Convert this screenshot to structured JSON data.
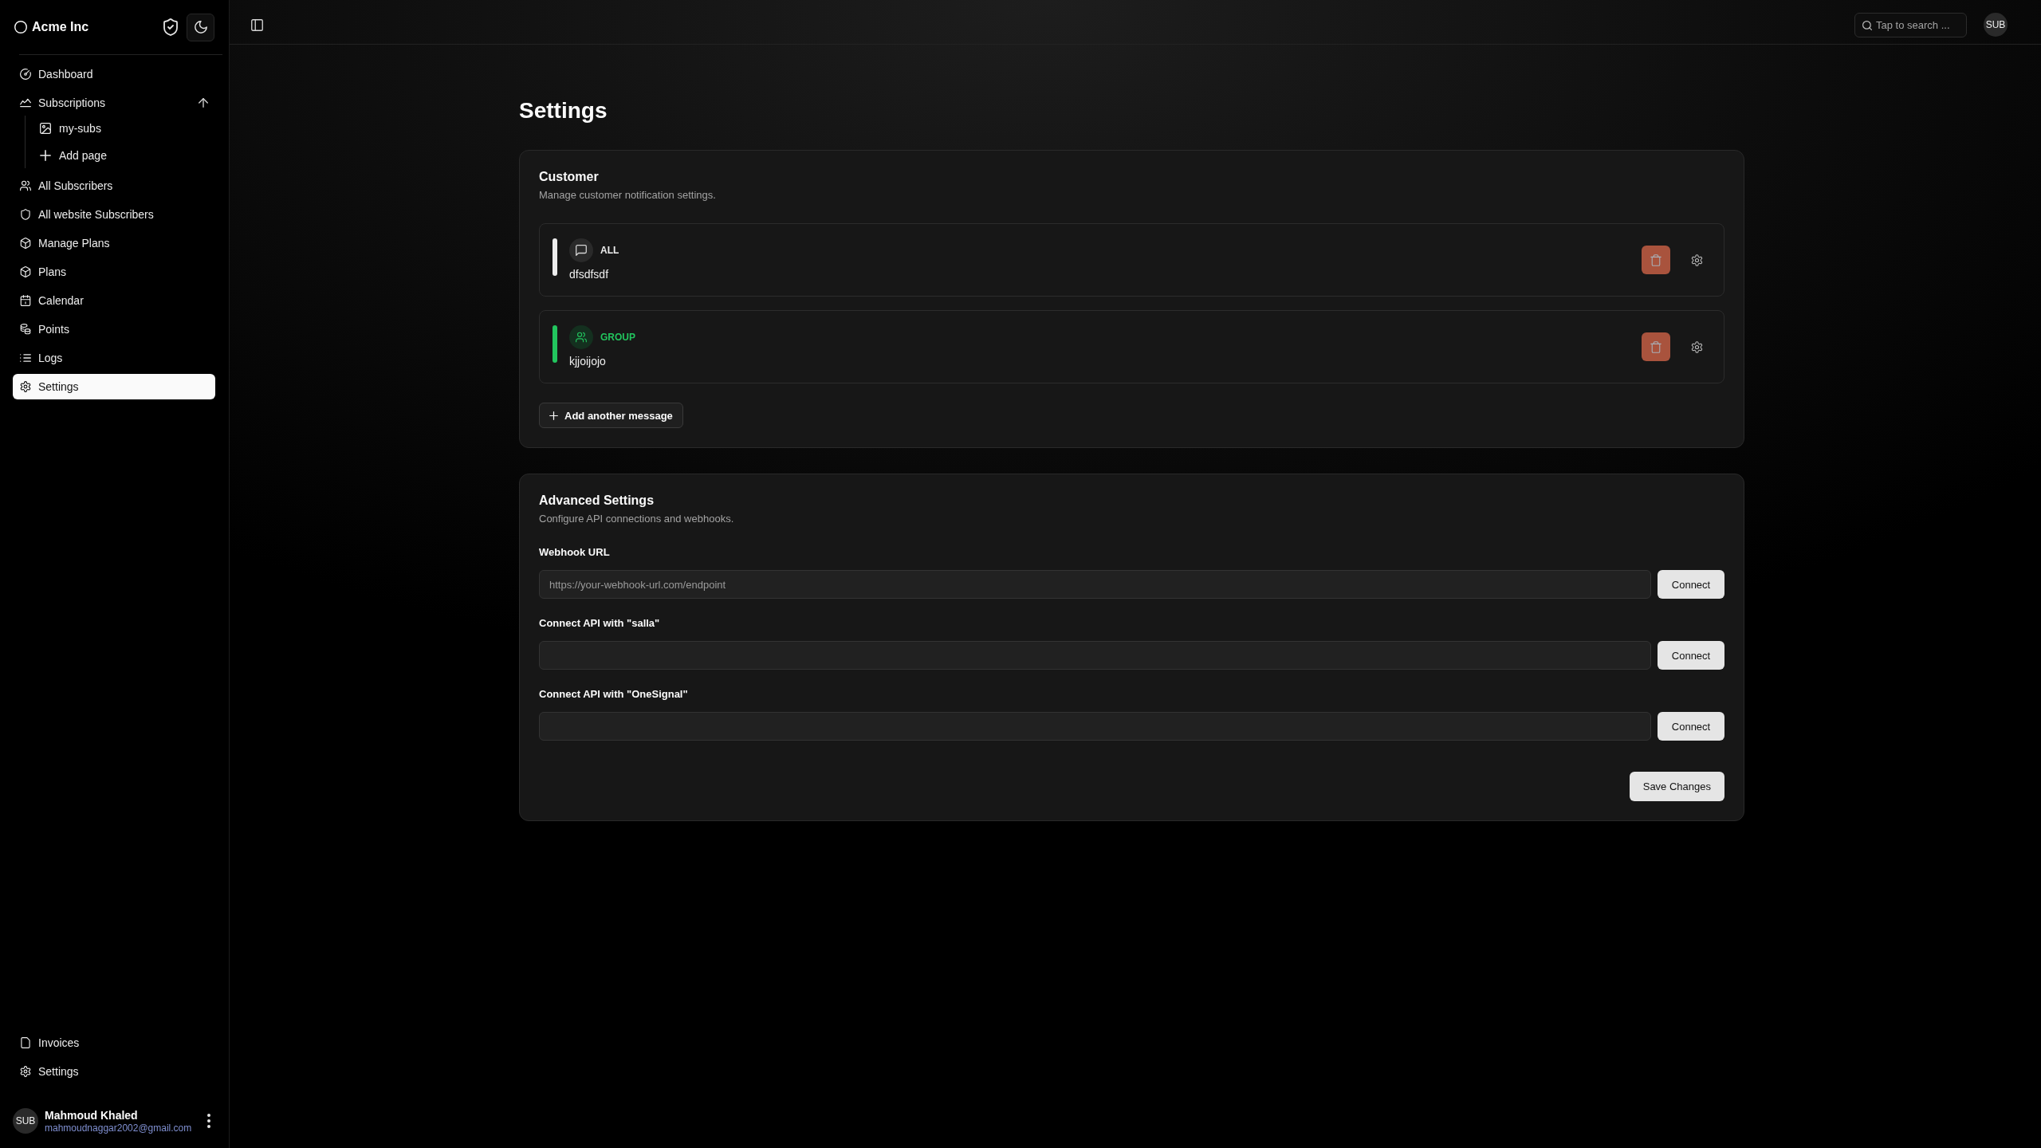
{
  "sidebar": {
    "brand": "Acme Inc",
    "nav": [
      {
        "label": "Dashboard",
        "selected": false
      },
      {
        "label": "Subscriptions",
        "selected": false,
        "expanded": true,
        "children": [
          {
            "label": "my-subs",
            "selected": false
          },
          {
            "label": "Add page",
            "selected": false
          }
        ]
      },
      {
        "label": "All Subscribers",
        "selected": false
      },
      {
        "label": "All website Subscribers",
        "selected": false
      },
      {
        "label": "Manage Plans",
        "selected": false
      },
      {
        "label": "Plans",
        "selected": false
      },
      {
        "label": "Calendar",
        "selected": false
      },
      {
        "label": "Points",
        "selected": false
      },
      {
        "label": "Logs",
        "selected": false
      },
      {
        "label": "Settings",
        "selected": true
      }
    ],
    "footer_nav": [
      {
        "label": "Invoices",
        "selected": false
      },
      {
        "label": "Settings",
        "selected": false
      }
    ],
    "user": {
      "avatar": "SUB",
      "name": "Mahmoud Khaled",
      "email": "mahmoudnaggar2002@gmail.com"
    }
  },
  "topbar": {
    "search": {
      "placeholder": "Tap to search ..."
    },
    "avatar": "SUB"
  },
  "page_title": "Settings",
  "customer": {
    "title": "Customer",
    "description": "Manage customer notification settings.",
    "messages": [
      {
        "kind": "all",
        "audience": "ALL",
        "text": "dfsdfsdf",
        "color": "#ededed"
      },
      {
        "kind": "group",
        "audience": "GROUP",
        "text": "kjjoijojo",
        "color": "#22c55e"
      }
    ],
    "add_button": "Add another message"
  },
  "advanced": {
    "title": "Advanced Settings",
    "description": "Configure API connections and webhooks.",
    "fields": [
      {
        "label": "Webhook URL",
        "placeholder": "https://your-webhook-url.com/endpoint",
        "button": "Connect"
      },
      {
        "label": "Connect API with \"salla\"",
        "button": "Connect"
      },
      {
        "label": "Connect API with \"OneSignal\"",
        "button": "Connect"
      }
    ],
    "save_button": "Save Changes"
  }
}
